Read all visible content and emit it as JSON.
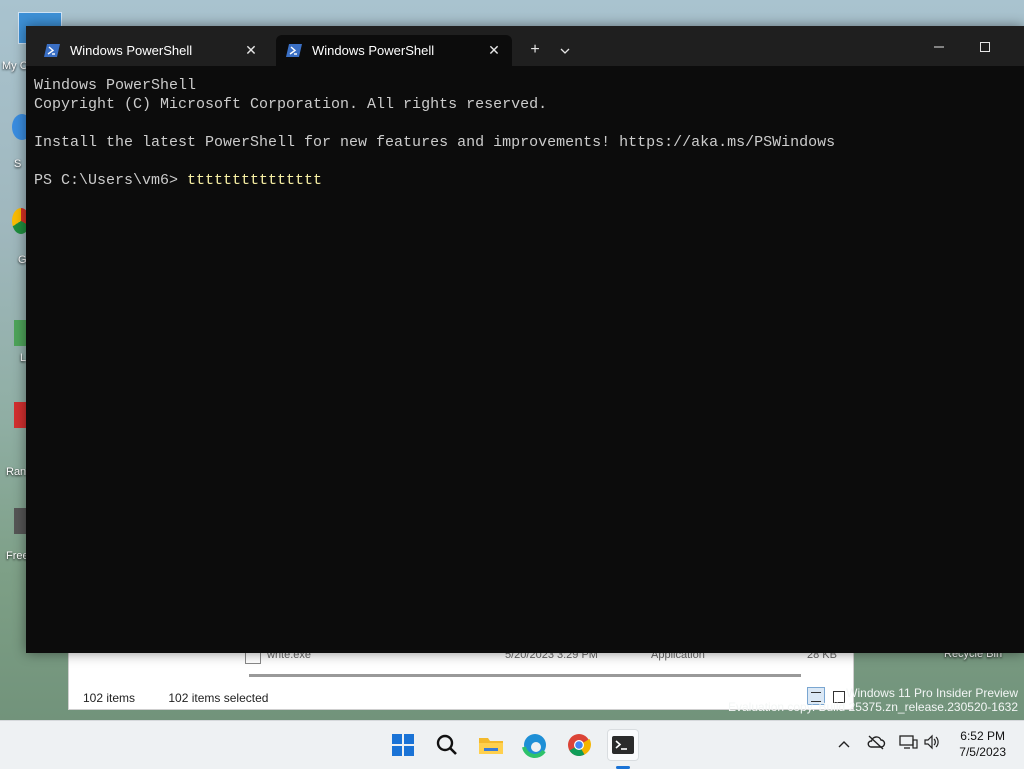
{
  "desktop": {
    "icons": [
      {
        "name": "my-computer",
        "label": "My C"
      },
      {
        "name": "screen",
        "label": "S"
      },
      {
        "name": "chrome",
        "label": "G"
      },
      {
        "name": "shortcut-l",
        "label": "L"
      },
      {
        "name": "shortcut-ran",
        "label": "Ran"
      },
      {
        "name": "shortcut-free",
        "label": "Free"
      }
    ],
    "recycle_bin_label": "Recycle Bin",
    "watermark": {
      "line1": "Windows 11 Pro Insider Preview",
      "line2": "Evaluation copy. Build 25375.zn_release.230520-1632"
    }
  },
  "explorer": {
    "row": {
      "name": "write.exe",
      "date": "5/20/2023 3:29 PM",
      "type": "Application",
      "size": "28 KB"
    },
    "status_items": "102 items",
    "status_selected": "102 items selected"
  },
  "terminal": {
    "tabs": [
      {
        "label": "Windows PowerShell",
        "active": false
      },
      {
        "label": "Windows PowerShell",
        "active": true
      }
    ],
    "new_tab": "+",
    "dropdown": "⌄",
    "minimize": "—",
    "maximize": "☐",
    "console": {
      "line1": "Windows PowerShell",
      "line2": "Copyright (C) Microsoft Corporation. All rights reserved.",
      "line3": "Install the latest PowerShell for new features and improvements! https://aka.ms/PSWindows",
      "prompt": "PS C:\\Users\\vm6> ",
      "command": "ttttttttttttttt"
    }
  },
  "taskbar": {
    "apps": [
      "start-icon",
      "search-icon",
      "file-explorer-icon",
      "edge-icon",
      "chrome-icon",
      "terminal-icon"
    ],
    "tray": {
      "chevron": "^"
    },
    "clock": {
      "time": "6:52 PM",
      "date": "7/5/2023"
    }
  },
  "colors": {
    "terminal_bg": "#0c0c0c",
    "titlebar_bg": "#1f1f1f",
    "command_text": "#f9f1a5",
    "console_text": "#cccccc",
    "ps_icon": "#3a6fc4",
    "taskbar_bg": "#eef1f3"
  }
}
